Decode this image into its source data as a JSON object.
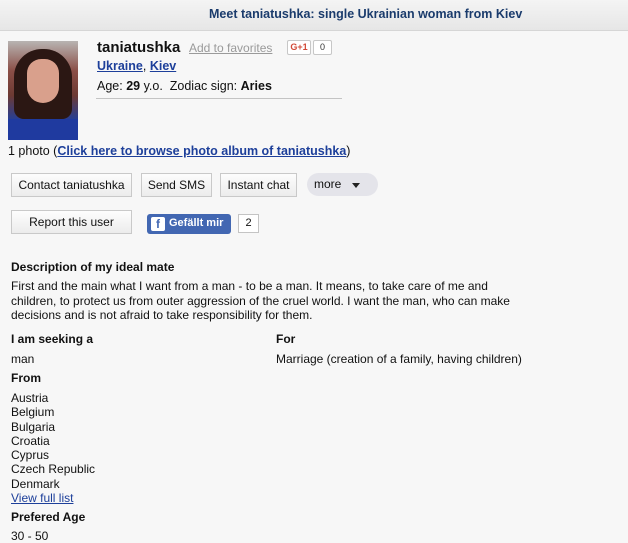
{
  "header": {
    "title": "Meet taniatushka: single Ukrainian woman from Kiev"
  },
  "profile": {
    "username": "taniatushka",
    "add_favorites": "Add to favorites",
    "gplus_label": "G+1",
    "gplus_count": "0",
    "country": "Ukraine",
    "city": "Kiev",
    "location_separator": ", ",
    "age_label": "Age: ",
    "age_value": "29",
    "age_unit": " y.o.",
    "zodiac_label": "Zodiac sign: ",
    "zodiac_value": "Aries"
  },
  "photos": {
    "count_text": "1 photo (",
    "album_link": "Click here to browse photo album of taniatushka",
    "close_paren": ")"
  },
  "actions": {
    "contact": "Contact taniatushka",
    "send_sms": "Send SMS",
    "instant_chat": "Instant chat",
    "more": "more",
    "report": "Report this user",
    "fb_like": "Gefällt mir",
    "fb_count": "2"
  },
  "details": {
    "ideal_mate_heading": "Description of my ideal mate",
    "ideal_mate_text": "First and the main what I want from a man - to be a man. It means, to take care of me and children, to protect us from outer aggression of the cruel world. I want the man, who can make decisions and is not afraid to take responsibility for them.",
    "seeking_heading": "I am seeking a",
    "seeking_value": "man",
    "for_heading": "For",
    "for_value": "Marriage (creation of a family, having children)",
    "from_heading": "From",
    "from_countries": [
      "Austria",
      "Belgium",
      "Bulgaria",
      "Croatia",
      "Cyprus",
      "Czech Republic",
      "Denmark"
    ],
    "view_full_list": "View full list",
    "age_heading": "Prefered Age",
    "age_value": "30 - 50"
  },
  "colors": {
    "link": "#1d3f9a",
    "header_text": "#1a3b6c",
    "facebook": "#4267b2"
  }
}
